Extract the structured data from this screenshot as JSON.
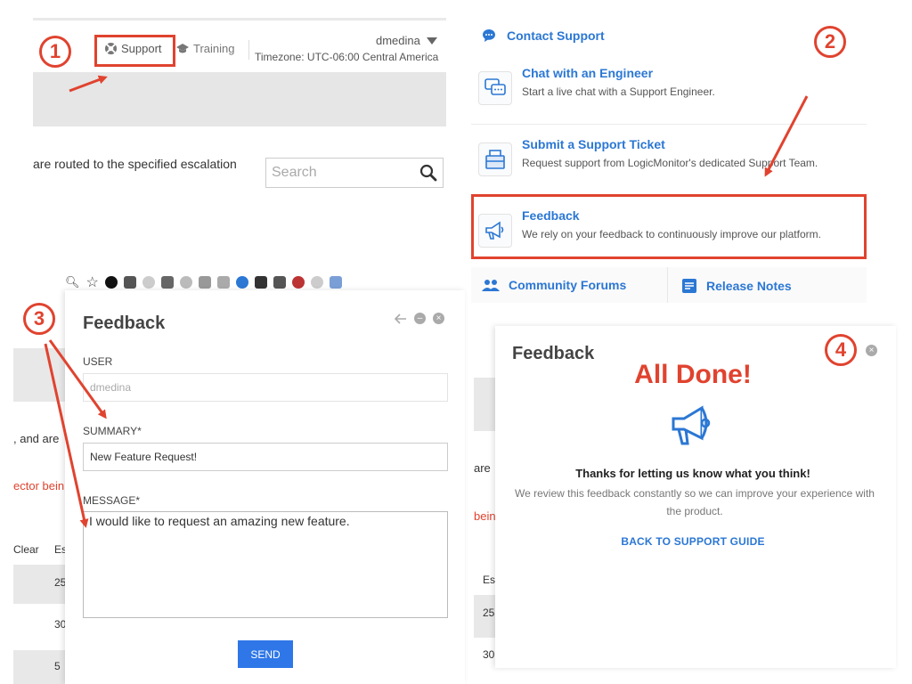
{
  "panel1": {
    "badge": "1",
    "nav": {
      "support_label": "Support",
      "training_label": "Training",
      "username": "dmedina",
      "timezone": "Timezone: UTC-06:00 Central America"
    },
    "escalation_text": "are routed to the specified escalation",
    "search": {
      "placeholder": "Search"
    }
  },
  "panel2": {
    "badge": "2",
    "header": "Contact Support",
    "options": [
      {
        "title": "Chat with an Engineer",
        "desc": "Start a live chat with a Support Engineer.",
        "icon": "chat-icon"
      },
      {
        "title": "Submit a Support Ticket",
        "desc": "Request support from LogicMonitor's dedicated Support Team.",
        "icon": "ticket-icon"
      },
      {
        "title": "Feedback",
        "desc": "We rely on your feedback to continuously improve our platform.",
        "icon": "megaphone-icon"
      }
    ],
    "bottom": {
      "community": "Community Forums",
      "release": "Release Notes"
    }
  },
  "panel3": {
    "badge": "3",
    "title": "Feedback",
    "user_label": "USER",
    "user_value": "dmedina",
    "summary_label": "SUMMARY*",
    "summary_value": "New Feature Request!",
    "message_label": "MESSAGE*",
    "message_value": "I would like to request an amazing new feature.",
    "send_label": "SEND",
    "bg": {
      "and_are": ", and are",
      "vector": "ector bein",
      "clear": "Clear",
      "es": "Es",
      "v25": "25",
      "v30": "30",
      "v5": "5"
    }
  },
  "panel4": {
    "badge": "4",
    "title": "Feedback",
    "all_done": "All Done!",
    "thanks": "Thanks for letting us know what you think!",
    "review": "We review this feedback constantly so we can improve your experience with the product.",
    "back_link": "BACK TO SUPPORT GUIDE",
    "bg": {
      "are": "are",
      "bein": "bein",
      "es": "Es",
      "v25": "25",
      "v30": "30"
    }
  },
  "colors": {
    "accent": "#2b77d4",
    "highlight": "#e0432f",
    "button": "#2f77e8"
  }
}
